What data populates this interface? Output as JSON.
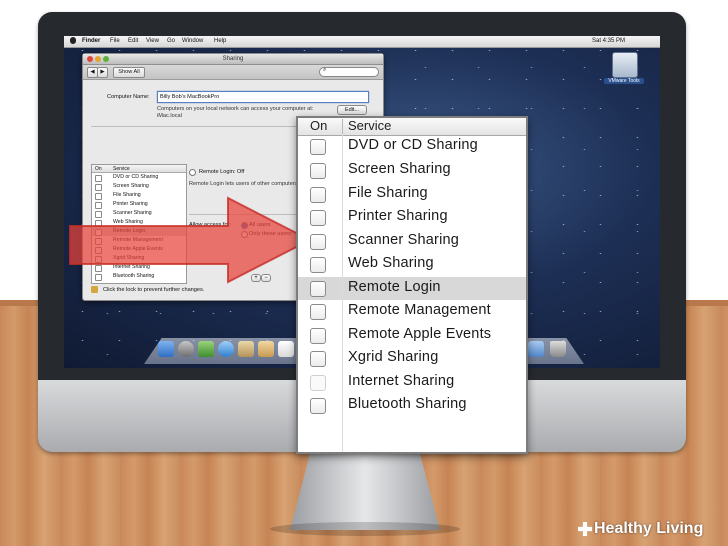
{
  "menubar": {
    "items": [
      "Finder",
      "File",
      "Edit",
      "View",
      "Go",
      "Window",
      "Help"
    ],
    "clock": "Sat 4:35 PM"
  },
  "desktop": {
    "vmware_label": "VMware Tools"
  },
  "sharing_window": {
    "title": "Sharing",
    "show_all": "Show All",
    "computer_name_label": "Computer Name:",
    "computer_name_value": "Billy Bob's MacBookPro",
    "computer_name_hint_1": "Computers on your local network can access your computer at:",
    "computer_name_hint_2": "iMac.local",
    "edit_button": "Edit...",
    "list_header_on": "On",
    "list_header_service": "Service",
    "services": [
      "DVD or CD Sharing",
      "Screen Sharing",
      "File Sharing",
      "Printer Sharing",
      "Scanner Sharing",
      "Web Sharing",
      "Remote Login",
      "Remote Management",
      "Remote Apple Events",
      "Xgrid Sharing",
      "Internet Sharing",
      "Bluetooth Sharing"
    ],
    "status_label": "Remote Login: Off",
    "status_desc": "Remote Login lets users of other computers",
    "allow_label": "Allow access for:",
    "allow_all": "All users",
    "allow_only": "Only these users:",
    "lock_text": "Click the lock to prevent further changes."
  },
  "zoom_panel": {
    "header_on": "On",
    "header_service": "Service",
    "services": [
      "DVD or CD Sharing",
      "Screen Sharing",
      "File Sharing",
      "Printer Sharing",
      "Scanner Sharing",
      "Web Sharing",
      "Remote Login",
      "Remote Management",
      "Remote Apple Events",
      "Xgrid Sharing",
      "Internet Sharing",
      "Bluetooth Sharing"
    ],
    "selected": "Remote Login"
  },
  "colors": {
    "arrow": "#e8433a",
    "selected_row": "#d8d8d8",
    "screen": "#1d2f55"
  },
  "watermark": "Healthy Living"
}
